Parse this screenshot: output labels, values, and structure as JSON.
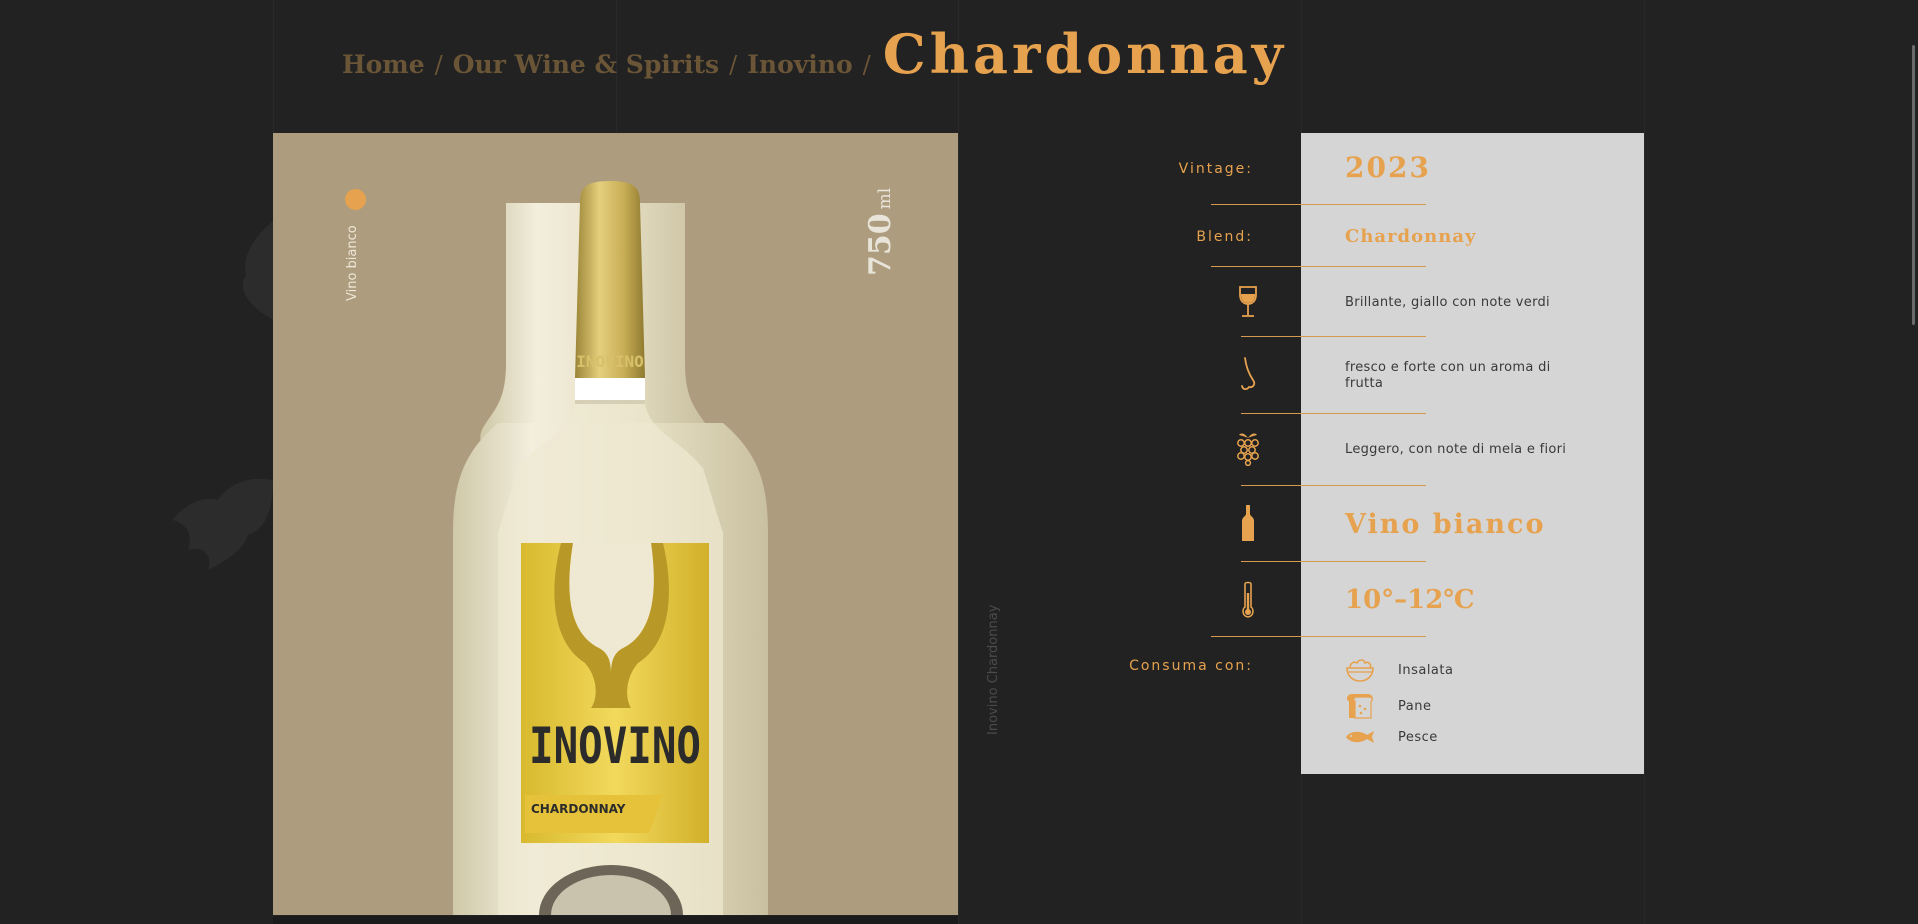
{
  "breadcrumb": {
    "items": [
      {
        "label": "Home"
      },
      {
        "label": "Our Wine & Spirits"
      },
      {
        "label": "Inovino"
      }
    ],
    "separator": "/",
    "current": "Chardonnay"
  },
  "product": {
    "type_label": "Vino bianco",
    "volume_value": "750",
    "volume_unit": "ml",
    "bottle_brand": "INOVINO",
    "bottle_neck_brand": "INOVINO",
    "bottle_variety": "CHARDONNAY",
    "side_caption": "Inovino Chardonnay"
  },
  "specs": {
    "vintage_label": "Vintage:",
    "vintage_value": "2023",
    "blend_label": "Blend:",
    "blend_value": "Chardonnay",
    "appearance": {
      "icon": "wine-glass-icon",
      "text": "Brillante, giallo con note verdi"
    },
    "aroma": {
      "icon": "nose-icon",
      "text": "fresco e forte con un aroma di frutta"
    },
    "taste": {
      "icon": "grapes-icon",
      "text": "Leggero, con note di mela e fiori"
    },
    "wine_type": {
      "icon": "bottle-icon",
      "text": "Vino bianco"
    },
    "temperature": {
      "icon": "thermometer-icon",
      "text": "10°–12℃"
    },
    "pairing_label": "Consuma con:",
    "pairings": [
      {
        "icon": "salad-bowl-icon",
        "label": "Insalata"
      },
      {
        "icon": "bread-icon",
        "label": "Pane"
      },
      {
        "icon": "fish-icon",
        "label": "Pesce"
      }
    ]
  },
  "colors": {
    "accent": "#e6a24f",
    "background": "#222222",
    "product_panel": "#ae9c7e",
    "spec_panel": "#d5d5d5"
  }
}
